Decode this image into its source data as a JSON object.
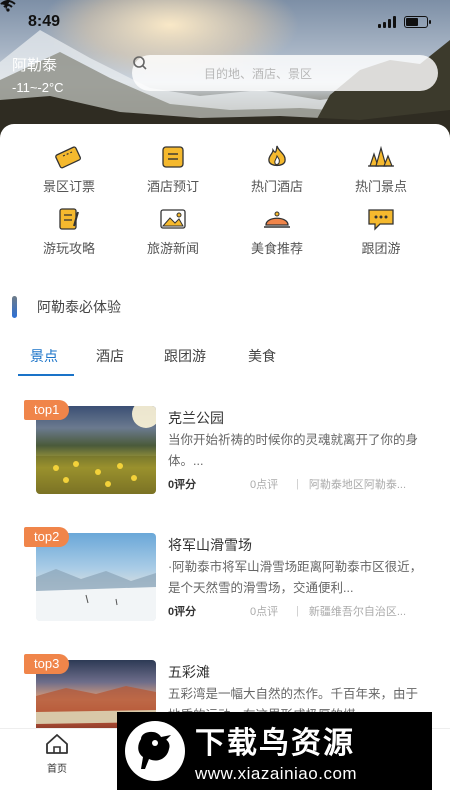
{
  "status_bar": {
    "time": "8:49"
  },
  "location": {
    "city": "阿勒泰",
    "temperature": "-11~-2°C"
  },
  "search": {
    "placeholder": "目的地、酒店、景区"
  },
  "categories": [
    {
      "label": "景区订票",
      "icon": "ticket-icon"
    },
    {
      "label": "酒店预订",
      "icon": "hotel-booking-icon"
    },
    {
      "label": "热门酒店",
      "icon": "flame-icon"
    },
    {
      "label": "热门景点",
      "icon": "landmark-icon"
    },
    {
      "label": "游玩攻略",
      "icon": "guide-book-icon"
    },
    {
      "label": "旅游新闻",
      "icon": "news-image-icon"
    },
    {
      "label": "美食推荐",
      "icon": "food-cloche-icon"
    },
    {
      "label": "跟团游",
      "icon": "chat-group-icon"
    }
  ],
  "section": {
    "title": "阿勒泰必体验"
  },
  "tabs": [
    "景点",
    "酒店",
    "跟团游",
    "美食"
  ],
  "active_tab": "景点",
  "items": [
    {
      "rank": "top1",
      "title": "克兰公园",
      "description": "当你开始祈祷的时候你的灵魂就离开了你的身体。...",
      "score": "0评分",
      "comments": "0点评",
      "address": "阿勒泰地区阿勒泰..."
    },
    {
      "rank": "top2",
      "title": "将军山滑雪场",
      "description": "·阿勒泰市将军山滑雪场距离阿勒泰市区很近，是个天然雪的滑雪场，交通便利...",
      "score": "0评分",
      "comments": "0点评",
      "address": "新疆维吾尔自治区..."
    },
    {
      "rank": "top3",
      "title": "五彩滩",
      "description": "五彩湾是一幅大自然的杰作。千百年来，由于地质的运动，在这里形成极厚的煤",
      "score": "",
      "comments": "",
      "address": ""
    }
  ],
  "bottom_nav": {
    "home_label": "首页"
  },
  "watermark": {
    "title": "下载鸟资源",
    "url": "www.xiazainiao.com"
  },
  "colors": {
    "accent": "#1a73c8",
    "rank_badge": "#f0854a",
    "icon_yellow": "#f5b92e"
  }
}
